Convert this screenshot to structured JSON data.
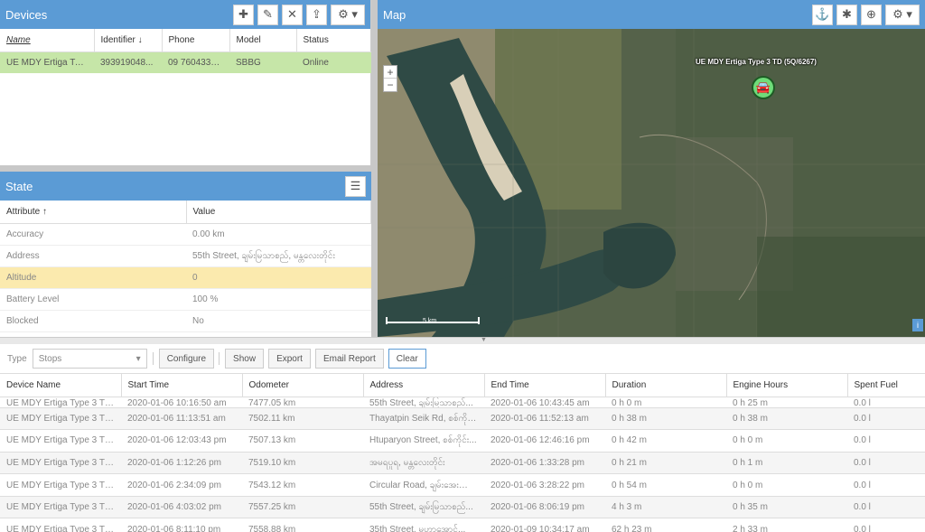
{
  "devices": {
    "title": "Devices",
    "columns": [
      "Name",
      "Identifier",
      "Phone",
      "Model",
      "Status"
    ],
    "rows": [
      {
        "name": "UE MDY Ertiga Type...",
        "identifier": "393919048...",
        "phone": "09 7604335...",
        "model": "SBBG",
        "status": "Online"
      }
    ]
  },
  "state": {
    "title": "State",
    "columns": [
      "Attribute",
      "Value"
    ],
    "rows": [
      {
        "attribute": "Accuracy",
        "value": "0.00 km"
      },
      {
        "attribute": "Address",
        "value": "55th Street, ချမ်းမြသာစည်, မန္တလေးတိုင်း"
      },
      {
        "attribute": "Altitude",
        "value": "0"
      },
      {
        "attribute": "Battery Level",
        "value": "100 %"
      },
      {
        "attribute": "Blocked",
        "value": "No"
      }
    ]
  },
  "map": {
    "title": "Map",
    "marker_label": "UE MDY Ertiga Type 3 TD (5Q/6267)",
    "scale_label": "5 km",
    "zoom_in": "+",
    "zoom_out": "−",
    "info": "i"
  },
  "report": {
    "type_label": "Type",
    "type_value": "Stops",
    "buttons": {
      "configure": "Configure",
      "show": "Show",
      "export": "Export",
      "email": "Email Report",
      "clear": "Clear"
    },
    "columns": [
      "Device Name",
      "Start Time",
      "Odometer",
      "Address",
      "End Time",
      "Duration",
      "Engine Hours",
      "Spent Fuel"
    ],
    "partial_row": [
      "UE MDY Ertiga Type 3 TD ...",
      "2020-01-06 10:16:50 am",
      "7477.05 km",
      "55th Street, ချမ်းမြသာစည်...",
      "2020-01-06 10:43:45 am",
      "0 h 0 m",
      "0 h 25 m",
      "0.0 l"
    ],
    "rows": [
      [
        "UE MDY Ertiga Type 3 TD ...",
        "2020-01-06 11:13:51 am",
        "7502.11 km",
        "Thayatpin Seik Rd, စစ်ကိုင်း...",
        "2020-01-06 11:52:13 am",
        "0 h 38 m",
        "0 h 38 m",
        "0.0 l"
      ],
      [
        "UE MDY Ertiga Type 3 TD ...",
        "2020-01-06 12:03:43 pm",
        "7507.13 km",
        "Htuparyon Street, စစ်ကိုင်း...",
        "2020-01-06 12:46:16 pm",
        "0 h 42 m",
        "0 h 0 m",
        "0.0 l"
      ],
      [
        "UE MDY Ertiga Type 3 TD ...",
        "2020-01-06 1:12:26 pm",
        "7519.10 km",
        "အမရပူရ, မန္တလေးတိုင်း",
        "2020-01-06 1:33:28 pm",
        "0 h 21 m",
        "0 h 1 m",
        "0.0 l"
      ],
      [
        "UE MDY Ertiga Type 3 TD ...",
        "2020-01-06 2:34:09 pm",
        "7543.12 km",
        "Circular Road, ချမ်းအေးသာ...",
        "2020-01-06 3:28:22 pm",
        "0 h 54 m",
        "0 h 0 m",
        "0.0 l"
      ],
      [
        "UE MDY Ertiga Type 3 TD ...",
        "2020-01-06 4:03:02 pm",
        "7557.25 km",
        "55th Street, ချမ်းမြသာစည်...",
        "2020-01-06 8:06:19 pm",
        "4 h 3 m",
        "0 h 35 m",
        "0.0 l"
      ],
      [
        "UE MDY Ertiga Type 3 TD ...",
        "2020-01-06 8:11:10 pm",
        "7558.88 km",
        "35th Street, မဟာအောင်...",
        "2020-01-09 10:34:17 am",
        "62 h 23 m",
        "2 h 33 m",
        "0.0 l"
      ]
    ]
  }
}
